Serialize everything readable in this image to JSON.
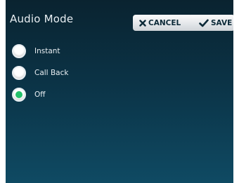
{
  "header": {
    "title": "Audio Mode",
    "cancel_label": "CANCEL",
    "save_label": "SAVE"
  },
  "options": [
    {
      "label": "Instant",
      "selected": false
    },
    {
      "label": "Call Back",
      "selected": false
    },
    {
      "label": "Off",
      "selected": true
    }
  ],
  "colors": {
    "accent": "#24c06b",
    "background_top": "#0a2330",
    "background_bottom": "#0f4a63"
  }
}
